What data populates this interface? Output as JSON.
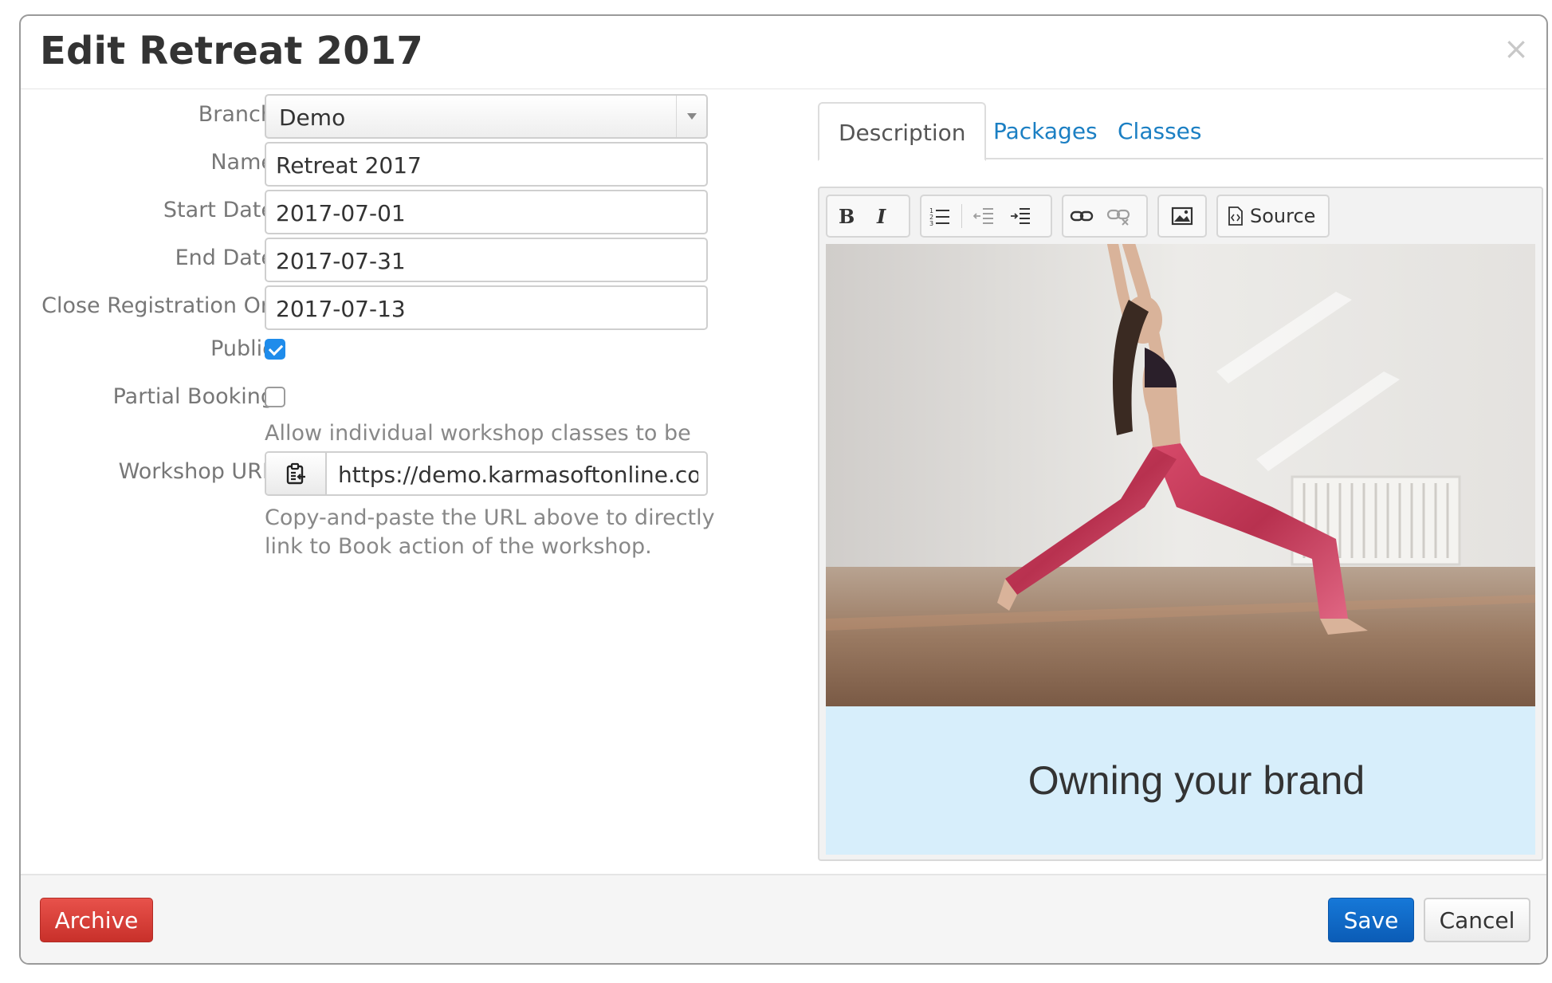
{
  "modal": {
    "title": "Edit Retreat 2017",
    "close_glyph": "×"
  },
  "form": {
    "branch": {
      "label": "Branch",
      "value": "Demo"
    },
    "name": {
      "label": "Name",
      "value": "Retreat 2017"
    },
    "start_date": {
      "label": "Start Date",
      "value": "2017-07-01"
    },
    "end_date": {
      "label": "End Date",
      "value": "2017-07-31"
    },
    "close_registration": {
      "label": "Close Registration On",
      "value": "2017-07-13"
    },
    "public": {
      "label": "Public",
      "checked": true
    },
    "partial_booking": {
      "label": "Partial Booking",
      "checked": false,
      "help": "Allow individual workshop classes to be booked."
    },
    "workshop_url": {
      "label": "Workshop URL",
      "value": "https://demo.karmasoftonline.com/m",
      "help": "Copy-and-paste the URL above to directly link to Book action of the workshop."
    }
  },
  "tabs": [
    {
      "label": "Description",
      "active": true
    },
    {
      "label": "Packages",
      "active": false
    },
    {
      "label": "Classes",
      "active": false
    }
  ],
  "editor": {
    "toolbar": {
      "source_label": "Source"
    },
    "banner_text": "Owning your brand"
  },
  "footer": {
    "archive_label": "Archive",
    "save_label": "Save",
    "cancel_label": "Cancel"
  },
  "colors": {
    "link": "#1b7fc3",
    "archive": "#d9403a",
    "save": "#0f6ac8",
    "checkbox": "#1f8ceb",
    "banner": "#d7eefb"
  }
}
